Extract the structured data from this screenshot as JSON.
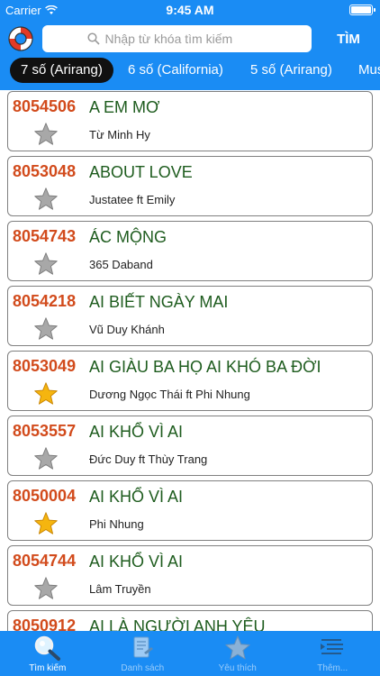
{
  "status": {
    "carrier": "Carrier",
    "time": "9:45 AM"
  },
  "search": {
    "placeholder": "Nhập từ khóa tìm kiếm",
    "button_label": "TÌM"
  },
  "tabs": [
    {
      "label": "7 số (Arirang)",
      "active": true
    },
    {
      "label": "6 số (California)",
      "active": false
    },
    {
      "label": "5 số (Arirang)",
      "active": false
    },
    {
      "label": "Mus",
      "active": false
    }
  ],
  "songs": [
    {
      "code": "8054506",
      "title": "A EM MƠ",
      "artist": "Từ Minh Hy",
      "favorite": false
    },
    {
      "code": "8053048",
      "title": "ABOUT LOVE",
      "artist": "Justatee ft Emily",
      "favorite": false
    },
    {
      "code": "8054743",
      "title": "ÁC MỘNG",
      "artist": "365 Daband",
      "favorite": false
    },
    {
      "code": "8054218",
      "title": "AI BIẾT NGÀY MAI",
      "artist": "Vũ Duy Khánh",
      "favorite": false
    },
    {
      "code": "8053049",
      "title": "AI GIÀU BA HỌ AI KHÓ BA ĐỜI",
      "artist": "Dương Ngọc Thái ft Phi Nhung",
      "favorite": true
    },
    {
      "code": "8053557",
      "title": "AI KHỔ VÌ AI",
      "artist": "Đức Duy ft Thùy Trang",
      "favorite": false
    },
    {
      "code": "8050004",
      "title": "AI KHỔ VÌ AI",
      "artist": "Phi Nhung",
      "favorite": true
    },
    {
      "code": "8054744",
      "title": "AI KHỔ VÌ AI",
      "artist": "Lâm Truyền",
      "favorite": false
    },
    {
      "code": "8050912",
      "title": "AI LÀ NGƯỜI ANH YÊU",
      "artist": "",
      "favorite": false
    }
  ],
  "tabbar": [
    {
      "label": "Tìm kiếm",
      "icon": "magnifier-icon",
      "active": true
    },
    {
      "label": "Danh sách",
      "icon": "document-icon",
      "active": false
    },
    {
      "label": "Yêu thích",
      "icon": "star-icon",
      "active": false
    },
    {
      "label": "Thêm...",
      "icon": "more-icon",
      "active": false
    }
  ],
  "colors": {
    "header_blue": "#1a8cf4",
    "code_orange": "#d24b1c",
    "title_green": "#1e5c1e"
  }
}
